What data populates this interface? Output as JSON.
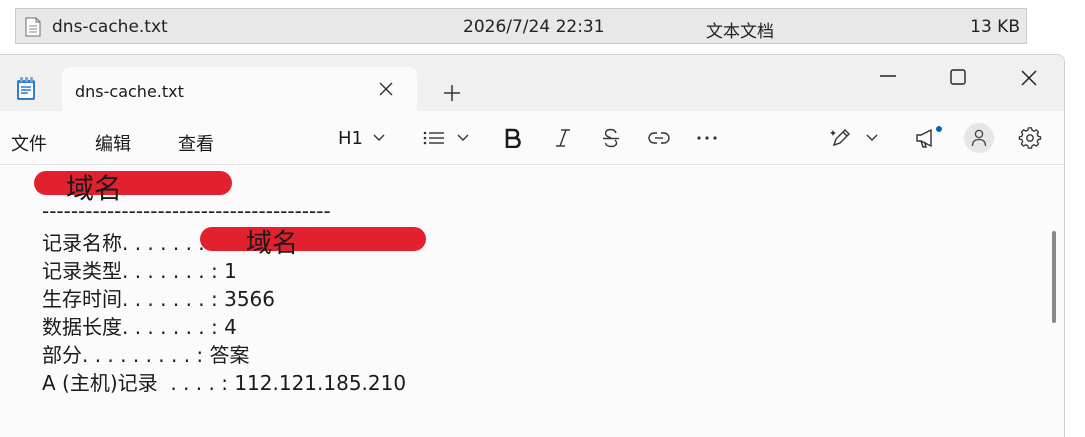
{
  "explorer": {
    "file": {
      "name": "dns-cache.txt",
      "modified": "2026/7/24 22:31",
      "type": "文本文档",
      "size": "13 KB"
    }
  },
  "notepad": {
    "tab_title": "dns-cache.txt",
    "menu": {
      "file": "文件",
      "edit": "编辑",
      "view": "查看"
    },
    "toolbar": {
      "heading_label": "H1",
      "notification_color": "#0067c0"
    },
    "document": {
      "heading": "域名",
      "separator": "----------------------------------------",
      "lines": {
        "record_name_label": "记录名称. . . . . . .",
        "record_name_value": "域名",
        "record_type": "记录类型. . . . . . . : 1",
        "ttl": "生存时间. . . . . . . : 3566",
        "data_length": "数据长度. . . . . . . : 4",
        "section": "部分. . . . . . . . . : 答案",
        "a_record": "A (主机)记录  . . . . : 112.121.185.210"
      }
    },
    "redaction_color": "#e3202e"
  }
}
